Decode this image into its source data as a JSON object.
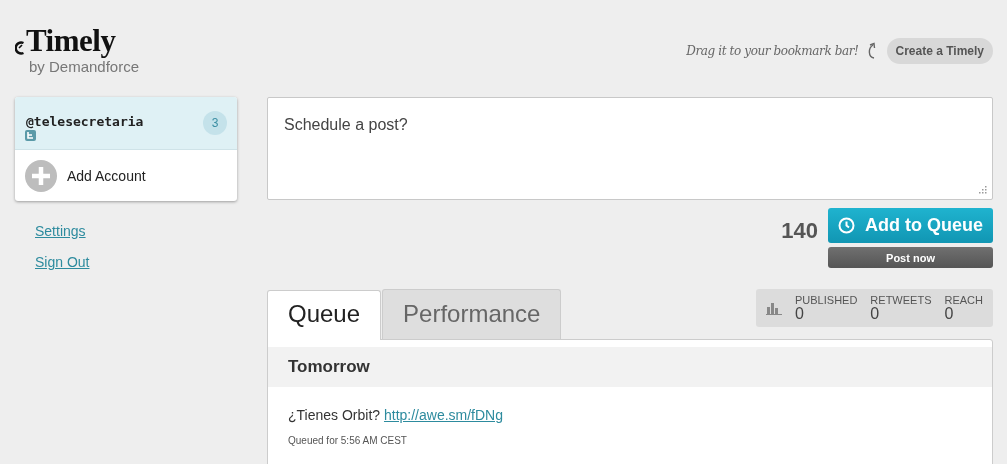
{
  "header": {
    "logo": "Timely",
    "byline": "by Demandforce",
    "hint": "Drag it to your bookmark bar!",
    "create_button": "Create a Timely"
  },
  "accounts": [
    {
      "name": "@telesecretaria",
      "count": "3",
      "selected": true
    }
  ],
  "add_account": "Add Account",
  "links": [
    "Settings",
    "Sign Out"
  ],
  "composer": {
    "placeholder": "Schedule a post?",
    "counter": "140",
    "add_button": "Add to Queue",
    "post_button": "Post now"
  },
  "tabs": [
    {
      "label": "Queue",
      "selected": true
    },
    {
      "label": "Performance",
      "selected": false
    }
  ],
  "stats": [
    {
      "label": "PUBLISHED",
      "value": "0"
    },
    {
      "label": "RETWEETS",
      "value": "0"
    },
    {
      "label": "REACH",
      "value": "0"
    }
  ],
  "queue": {
    "day": "Tomorrow",
    "posts": [
      {
        "text": "¿Tienes Orbit?",
        "link": "http://awe.sm/fDNg",
        "meta": "Queued for 5:56 AM CEST"
      }
    ]
  }
}
